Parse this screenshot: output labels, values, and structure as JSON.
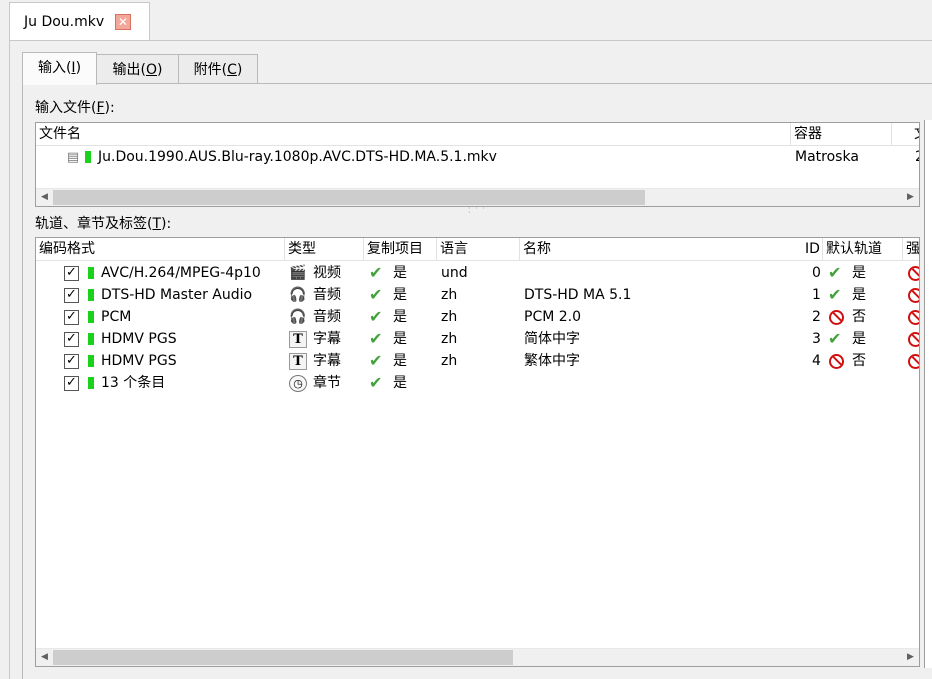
{
  "document_tab": {
    "title": "Ju Dou.mkv",
    "close_glyph": "✕"
  },
  "tabs": [
    {
      "label": "输入(",
      "key": "I",
      "close": ")"
    },
    {
      "label": "输出(",
      "key": "O",
      "close": ")"
    },
    {
      "label": "附件(",
      "key": "C",
      "close": ")"
    }
  ],
  "input_files": {
    "label": "输入文件(",
    "key": "F",
    "close": "):",
    "columns": [
      "文件名",
      "容器",
      "文"
    ],
    "rows": [
      {
        "filename": "Ju.Dou.1990.AUS.Blu-ray.1080p.AVC.DTS-HD.MA.5.1.mkv",
        "container": "Matroska",
        "extra": "2"
      }
    ],
    "scroll_left": "◀",
    "scroll_right": "▶"
  },
  "tracks": {
    "label": "轨道、章节及标签(",
    "key": "T",
    "close": "):",
    "columns": [
      "编码格式",
      "类型",
      "复制项目",
      "语言",
      "名称",
      "ID",
      "默认轨道",
      "强"
    ],
    "rows": [
      {
        "codec": "AVC/H.264/MPEG-4p10",
        "type_icon": "film-icon",
        "type": "视频",
        "copy": "是",
        "language": "und",
        "name": "",
        "id": "0",
        "default": "是",
        "default_state": "yes",
        "checked": "✓"
      },
      {
        "codec": "DTS-HD Master Audio",
        "type_icon": "headphones-icon",
        "type": "音频",
        "copy": "是",
        "language": "zh",
        "name": "DTS-HD MA 5.1",
        "id": "1",
        "default": "是",
        "default_state": "yes",
        "checked": "✓"
      },
      {
        "codec": "PCM",
        "type_icon": "headphones-icon",
        "type": "音频",
        "copy": "是",
        "language": "zh",
        "name": "PCM 2.0",
        "id": "2",
        "default": "否",
        "default_state": "no",
        "checked": "✓"
      },
      {
        "codec": "HDMV PGS",
        "type_icon": "text-icon",
        "type": "字幕",
        "copy": "是",
        "language": "zh",
        "name": "简体中字",
        "id": "3",
        "default": "是",
        "default_state": "yes",
        "checked": "✓"
      },
      {
        "codec": "HDMV PGS",
        "type_icon": "text-icon",
        "type": "字幕",
        "copy": "是",
        "language": "zh",
        "name": "繁体中字",
        "id": "4",
        "default": "否",
        "default_state": "no",
        "checked": "✓"
      },
      {
        "codec": "13 个条目",
        "type_icon": "clock-icon",
        "type": "章节",
        "copy": "是",
        "language": "",
        "name": "",
        "id": "",
        "default": "",
        "default_state": "",
        "checked": "✓"
      }
    ],
    "scroll_left": "◀",
    "scroll_right": "▶"
  },
  "icons": {
    "check_mark": "✔",
    "film": "🎬",
    "headphones": "🎧",
    "text": "T",
    "clock": "◷",
    "doc": "▤"
  },
  "colors": {
    "tab_close_bg": "#f2a79a",
    "green_marker": "#1bd11b",
    "check_green": "#41a23a",
    "no_red": "#d01010"
  }
}
